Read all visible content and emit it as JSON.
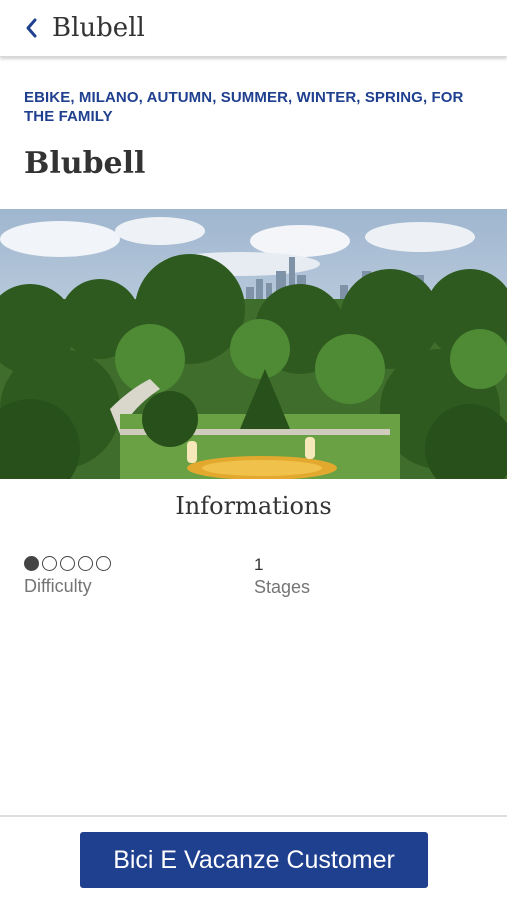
{
  "header": {
    "title": "Blubell",
    "back_icon": "chevron-left-icon"
  },
  "tour": {
    "tags": "EBIKE, MILANO, AUTUMN, SUMMER, WINTER, SPRING, FOR THE FAMILY",
    "name": "Blubell"
  },
  "informations": {
    "heading": "Informations",
    "difficulty": {
      "label": "Difficulty",
      "level": 1,
      "max": 5
    },
    "stages": {
      "label": "Stages",
      "value": "1"
    }
  },
  "footer": {
    "button_label": "Bici E Vacanze Customer"
  },
  "colors": {
    "accent": "#1f3f8f"
  }
}
